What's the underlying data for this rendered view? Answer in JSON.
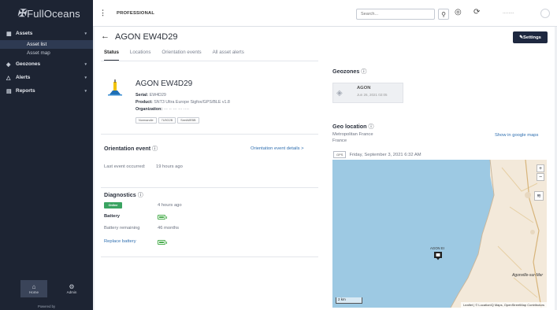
{
  "brand": {
    "logo_mark": "✠",
    "logo_text": "FullOceans"
  },
  "sidebar": {
    "items": [
      {
        "label": "Assets",
        "icon": "▦"
      },
      {
        "label": "Geozones",
        "icon": "◈"
      },
      {
        "label": "Alerts",
        "icon": "△"
      },
      {
        "label": "Reports",
        "icon": "▤"
      }
    ],
    "sub_items": [
      {
        "label": "Asset list"
      },
      {
        "label": "Asset map"
      }
    ],
    "bottom": {
      "home_label": "Home",
      "admin_label": "Admin",
      "powered_by": "Powered by"
    }
  },
  "topbar": {
    "breadcrumb": "PROFESSIONAL",
    "search_placeholder": "Search...",
    "username": "········"
  },
  "page": {
    "title": "AGON EW4D29",
    "settings_label": "Settings",
    "tabs": [
      "Status",
      "Locations",
      "Orientation events",
      "All asset alerts"
    ]
  },
  "asset": {
    "name": "AGON EW4D29",
    "serial_label": "Serial:",
    "serial_value": "EW4D29",
    "product_label": "Product:",
    "product_value": "SNT3 Ultra Europe Sigfox/GPS/BLE v1.8",
    "org_label": "Organization:",
    "org_value": "··· ·· ··· ··· ····",
    "tags": [
      "Normandie",
      "7U3G2B",
      "SeekMEBB"
    ]
  },
  "orientation": {
    "title": "Orientation event",
    "details_link": "Orientation event details >",
    "last_label": "Last event occurred:",
    "last_value": "19 hours ago"
  },
  "diagnostics": {
    "title": "Diagnostics",
    "status_badge": "Online",
    "status_time": "4 hours ago",
    "battery_label": "Battery",
    "battery_level": 1.0,
    "remaining_label": "Battery remaining",
    "remaining_value": "46 months",
    "replace_link": "Replace battery"
  },
  "geozones": {
    "title": "Geozones",
    "zone_name": "AGON",
    "zone_date": "Jun 26, 2021 02:05"
  },
  "geolocation": {
    "title": "Geo location",
    "region": "Metropolitan France",
    "country": "France",
    "google_link": "Show in google maps",
    "gps_badge": "GPS",
    "timestamp": "Friday, September 3, 2021 6:32 AM"
  },
  "map": {
    "marker_label": "AGON EI",
    "place_label": "Agonville-sur-Mer",
    "scale_label": "2 km",
    "attribution": "Leaflet | © LocationIQ Maps, OpenStreetMap Contributors",
    "zoom_in": "+",
    "zoom_out": "−",
    "water_color": "#9dc9e3",
    "land_color": "#f3e9da"
  },
  "icons": {
    "help": "ⓘ",
    "back": "←",
    "search": "⚲",
    "settings_pen": "✎"
  }
}
